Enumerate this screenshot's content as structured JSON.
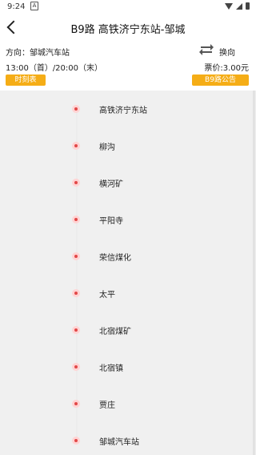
{
  "status": {
    "time": "9:24",
    "icon_a": "A"
  },
  "header": {
    "title": "B9路 高铁济宁东站-邹城",
    "direction": "方向：邹城汽车站",
    "swap_label": "换向",
    "hours": "13:00（首）/20:00（末）",
    "fare": "票价:3.00元",
    "timetable_button": "时刻表",
    "notice_button": "B9路公告"
  },
  "stops": [
    {
      "name": "高铁济宁东站"
    },
    {
      "name": "柳沟"
    },
    {
      "name": "横河矿"
    },
    {
      "name": "平阳寺"
    },
    {
      "name": "荣信煤化"
    },
    {
      "name": "太平"
    },
    {
      "name": "北宿煤矿"
    },
    {
      "name": "北宿镇"
    },
    {
      "name": "贾庄"
    },
    {
      "name": "邹城汽车站"
    }
  ],
  "colors": {
    "accent": "#f5ad16",
    "stop_dot": "#e24848"
  }
}
